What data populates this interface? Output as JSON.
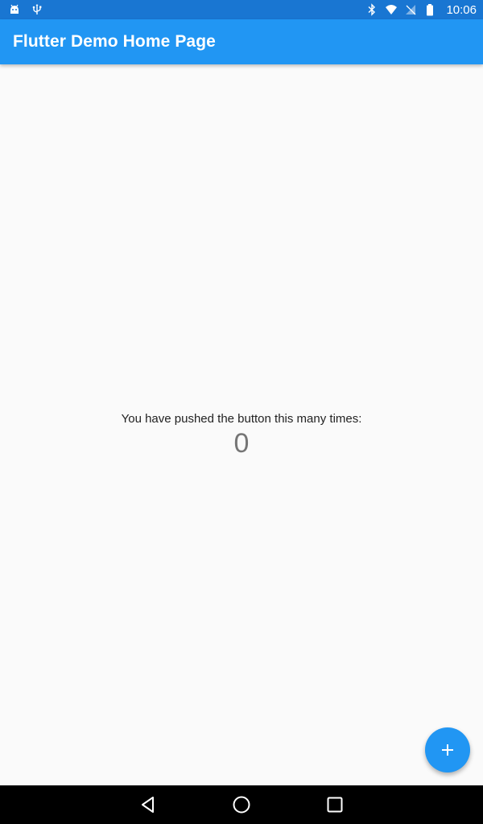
{
  "status_bar": {
    "time": "10:06",
    "icons": [
      "android-icon",
      "usb-icon",
      "bluetooth-icon",
      "wifi-icon",
      "no-signal-icon",
      "battery-icon"
    ],
    "color": "#1976d2"
  },
  "app_bar": {
    "title": "Flutter Demo Home Page",
    "color": "#2196f3"
  },
  "main": {
    "counter_label": "You have pushed the button this many times:",
    "counter_value": "0"
  },
  "fab": {
    "icon": "add-icon",
    "color": "#2196f3"
  },
  "nav_bar": {
    "buttons": [
      "back-icon",
      "home-icon",
      "recents-icon"
    ]
  }
}
